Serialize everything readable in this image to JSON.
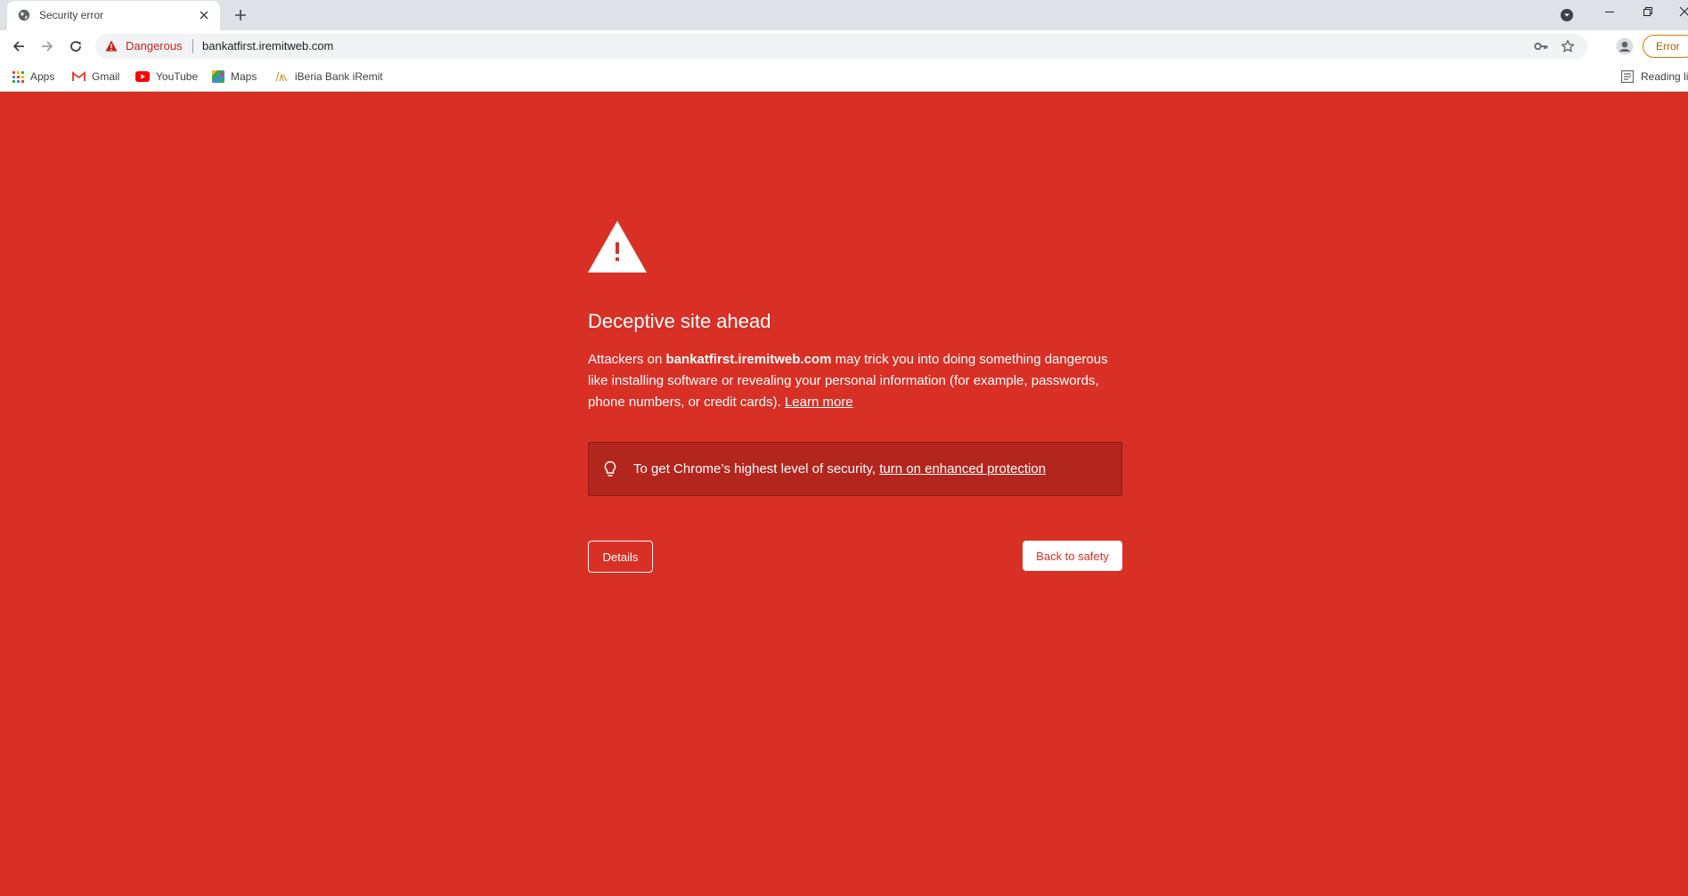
{
  "colors": {
    "page_background": "#d93025",
    "danger_text": "#c5221f",
    "tip_background": "#b3261e",
    "tab_strip": "#dee1e6"
  },
  "tab": {
    "title": "Security error",
    "favicon": "globe-icon"
  },
  "toolbar": {
    "security_label": "Dangerous",
    "url": "bankatfirst.iremitweb.com",
    "error_chip": "Error"
  },
  "bookmarks": [
    {
      "label": "Apps",
      "icon": "apps-grid-icon"
    },
    {
      "label": "Gmail",
      "icon": "gmail-icon"
    },
    {
      "label": "YouTube",
      "icon": "youtube-icon"
    },
    {
      "label": "Maps",
      "icon": "maps-icon"
    },
    {
      "label": "iBeria Bank iRemit",
      "icon": "iberia-bank-icon"
    }
  ],
  "reading_list": "Reading li",
  "interstitial": {
    "heading": "Deceptive site ahead",
    "para_prefix": "Attackers on ",
    "para_host": "bankatfirst.iremitweb.com",
    "para_suffix": " may trick you into doing something dangerous like installing software or revealing your personal information (for example, passwords, phone numbers, or credit cards). ",
    "learn_more": "Learn more",
    "tip_text": "To get Chrome’s highest level of security, ",
    "tip_link": "turn on enhanced protection",
    "details_button": "Details",
    "back_button": "Back to safety"
  }
}
